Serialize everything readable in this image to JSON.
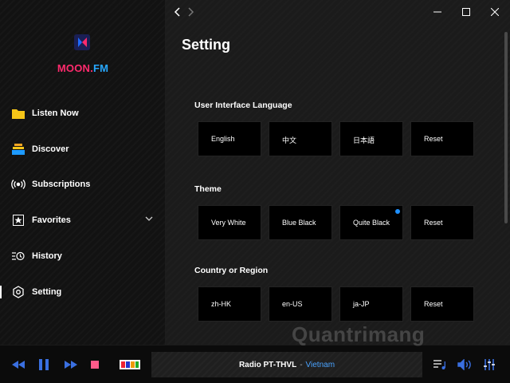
{
  "app": {
    "logo_text_a": "MOON.",
    "logo_text_b": "FM",
    "brand_colors": {
      "pink": "#ff2a6d",
      "blue": "#27a8ff"
    }
  },
  "nav": [
    {
      "label": "Listen Now",
      "icon": "folder-icon"
    },
    {
      "label": "Discover",
      "icon": "stack-icon"
    },
    {
      "label": "Subscriptions",
      "icon": "broadcast-icon"
    },
    {
      "label": "Favorites",
      "icon": "star-icon"
    },
    {
      "label": "History",
      "icon": "history-icon"
    },
    {
      "label": "Setting",
      "icon": "settings-icon",
      "active": true
    }
  ],
  "page": {
    "title": "Setting"
  },
  "sections": [
    {
      "title": "User Interface Language",
      "options": [
        "English",
        "中文",
        "日本語",
        "Reset"
      ]
    },
    {
      "title": "Theme",
      "options": [
        "Very White",
        "Blue Black",
        "Quite Black",
        "Reset"
      ],
      "selected": "Quite Black"
    },
    {
      "title": "Country or Region",
      "options": [
        "zh-HK",
        "en-US",
        "ja-JP",
        "Reset"
      ]
    }
  ],
  "player": {
    "station": "Radio PT-THVL",
    "separator": "-",
    "country": "Vietnam"
  },
  "watermark": "Quantrimang"
}
